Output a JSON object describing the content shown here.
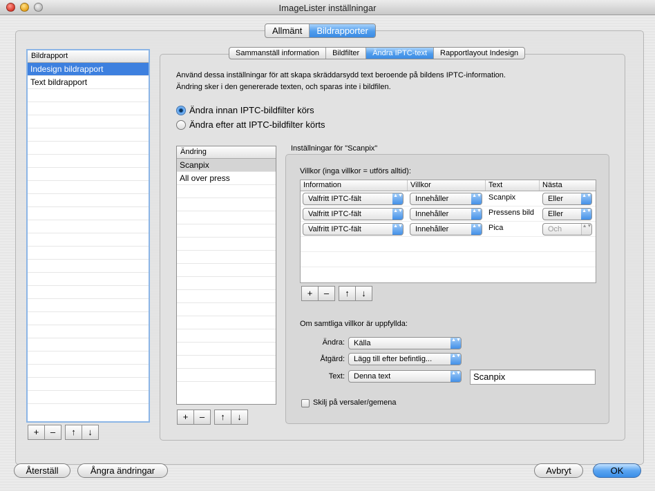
{
  "window": {
    "title": "ImageLister inställningar"
  },
  "top_tabs": [
    "Allmänt",
    "Bildrapporter"
  ],
  "sub_tabs": [
    "Sammanställ information",
    "Bildfilter",
    "Ändra IPTC-text",
    "Rapportlayout Indesign"
  ],
  "report_list": {
    "header": "Bildrapport",
    "items": [
      "Indesign bildrapport",
      "Text bildrapport"
    ]
  },
  "description": {
    "line1": "Använd dessa inställningar för att skapa skräddarsydd text beroende på bildens IPTC-information.",
    "line2": "Ändring sker i den genererade texten, och sparas inte i bildfilen."
  },
  "radio": {
    "before": "Ändra innan IPTC-bildfilter körs",
    "after": "Ändra efter att IPTC-bildfilter körts"
  },
  "changes_list": {
    "header": "Ändring",
    "items": [
      "Scanpix",
      "All over press"
    ]
  },
  "settings_group": {
    "title": "Inställningar för \"Scanpix\""
  },
  "conditions": {
    "label": "Villkor (inga villkor = utförs alltid):",
    "columns": [
      "Information",
      "Villkor",
      "Text",
      "Nästa"
    ],
    "rows": [
      {
        "information": "Valfritt IPTC-fält",
        "villkor": "Innehåller",
        "text": "Scanpix",
        "nasta": "Eller"
      },
      {
        "information": "Valfritt IPTC-fält",
        "villkor": "Innehåller",
        "text": "Pressens bild",
        "nasta": "Eller"
      },
      {
        "information": "Valfritt IPTC-fält",
        "villkor": "Innehåller",
        "text": "Pica",
        "nasta": "Och"
      }
    ]
  },
  "fulfilled": {
    "label": "Om samtliga villkor är uppfyllda:",
    "andra_label": "Ändra:",
    "andra_value": "Källa",
    "atgard_label": "Åtgärd:",
    "atgard_value": "Lägg till efter befintlig...",
    "text_label": "Text:",
    "text_value": "Denna text",
    "text_field": "Scanpix"
  },
  "case_checkbox": "Skilj på versaler/gemena",
  "bottom_buttons": {
    "reset": "Återställ",
    "undo": "Ångra ändringar",
    "cancel": "Avbryt",
    "ok": "OK"
  },
  "button_glyphs": {
    "add": "+",
    "remove": "–",
    "up": "↑",
    "down": "↓",
    "popup_arrows": "▲▼"
  },
  "accent_color": "#3d80df"
}
